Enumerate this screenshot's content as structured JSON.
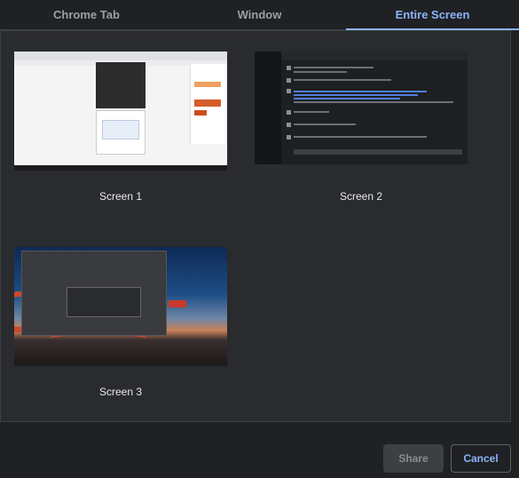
{
  "tabs": [
    {
      "label": "Chrome Tab",
      "active": false
    },
    {
      "label": "Window",
      "active": false
    },
    {
      "label": "Entire Screen",
      "active": true
    }
  ],
  "screens": [
    {
      "label": "Screen 1"
    },
    {
      "label": "Screen 2"
    },
    {
      "label": "Screen 3"
    }
  ],
  "buttons": {
    "share_label": "Share",
    "cancel_label": "Cancel"
  },
  "colors": {
    "background": "#202124",
    "panel": "#2a2b2e",
    "accent": "#8ab4f8",
    "share_button": "#3c4043"
  }
}
